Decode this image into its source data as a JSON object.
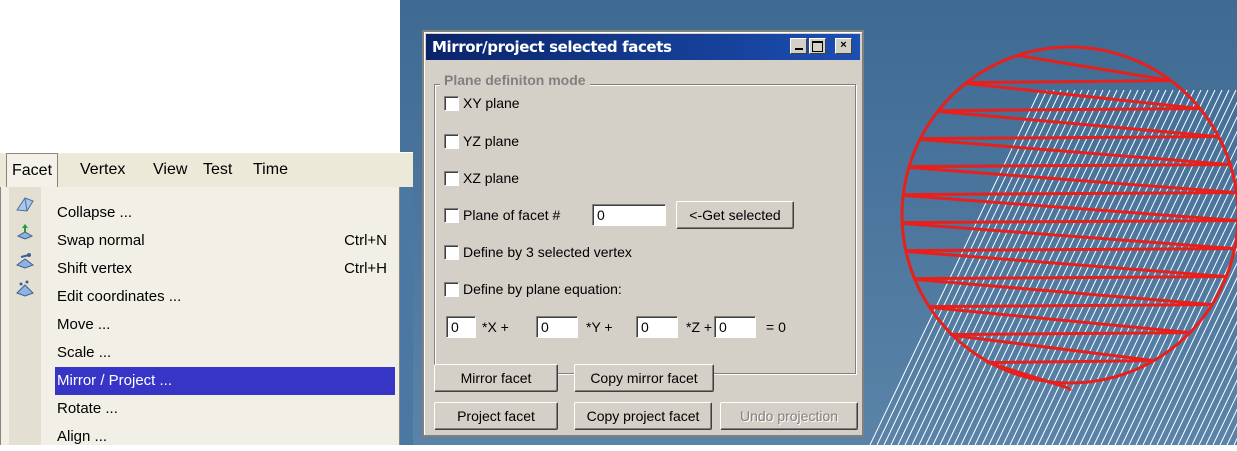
{
  "menubar": {
    "items": [
      "Facet",
      "Vertex",
      "View",
      "Test",
      "Time"
    ]
  },
  "facet_menu": {
    "items": [
      {
        "label": "Collapse ...",
        "shortcut": "",
        "icon": "collapse-icon"
      },
      {
        "label": "Swap normal",
        "shortcut": "Ctrl+N",
        "icon": "swap-normal-icon"
      },
      {
        "label": "Shift vertex",
        "shortcut": "Ctrl+H",
        "icon": "shift-vertex-icon"
      },
      {
        "label": "Edit coordinates ...",
        "shortcut": "",
        "icon": "edit-coordinates-icon"
      },
      {
        "label": "Move ...",
        "shortcut": ""
      },
      {
        "label": "Scale ...",
        "shortcut": ""
      },
      {
        "label": "Mirror / Project ...",
        "shortcut": "",
        "selected": true
      },
      {
        "label": "Rotate ...",
        "shortcut": ""
      },
      {
        "label": "Align ...",
        "shortcut": ""
      }
    ]
  },
  "dialog": {
    "title": "Mirror/project selected facets",
    "group_title": "Plane definiton mode",
    "options": {
      "xy": "XY plane",
      "yz": "YZ plane",
      "xz": "XZ plane",
      "facet": "Plane of facet #",
      "three_vertex": "Define by 3 selected vertex",
      "equation": "Define by plane equation:"
    },
    "facet_number": "0",
    "get_selected": "<-Get selected",
    "equation": {
      "a": "0",
      "b": "0",
      "c": "0",
      "d": "0",
      "x_label": "*X +",
      "y_label": "*Y +",
      "z_label": "*Z +",
      "eq_label": "= 0"
    },
    "buttons": {
      "mirror": "Mirror facet",
      "copy_mirror": "Copy mirror facet",
      "project": "Project facet",
      "copy_project": "Copy project facet",
      "undo": "Undo projection"
    }
  },
  "colors": {
    "viewport": "#4d78a0",
    "wire_red": "#e8201c",
    "wire_white": "#ffffff",
    "menu_highlight": "#3635c6",
    "title_bar": "#0a246a"
  }
}
